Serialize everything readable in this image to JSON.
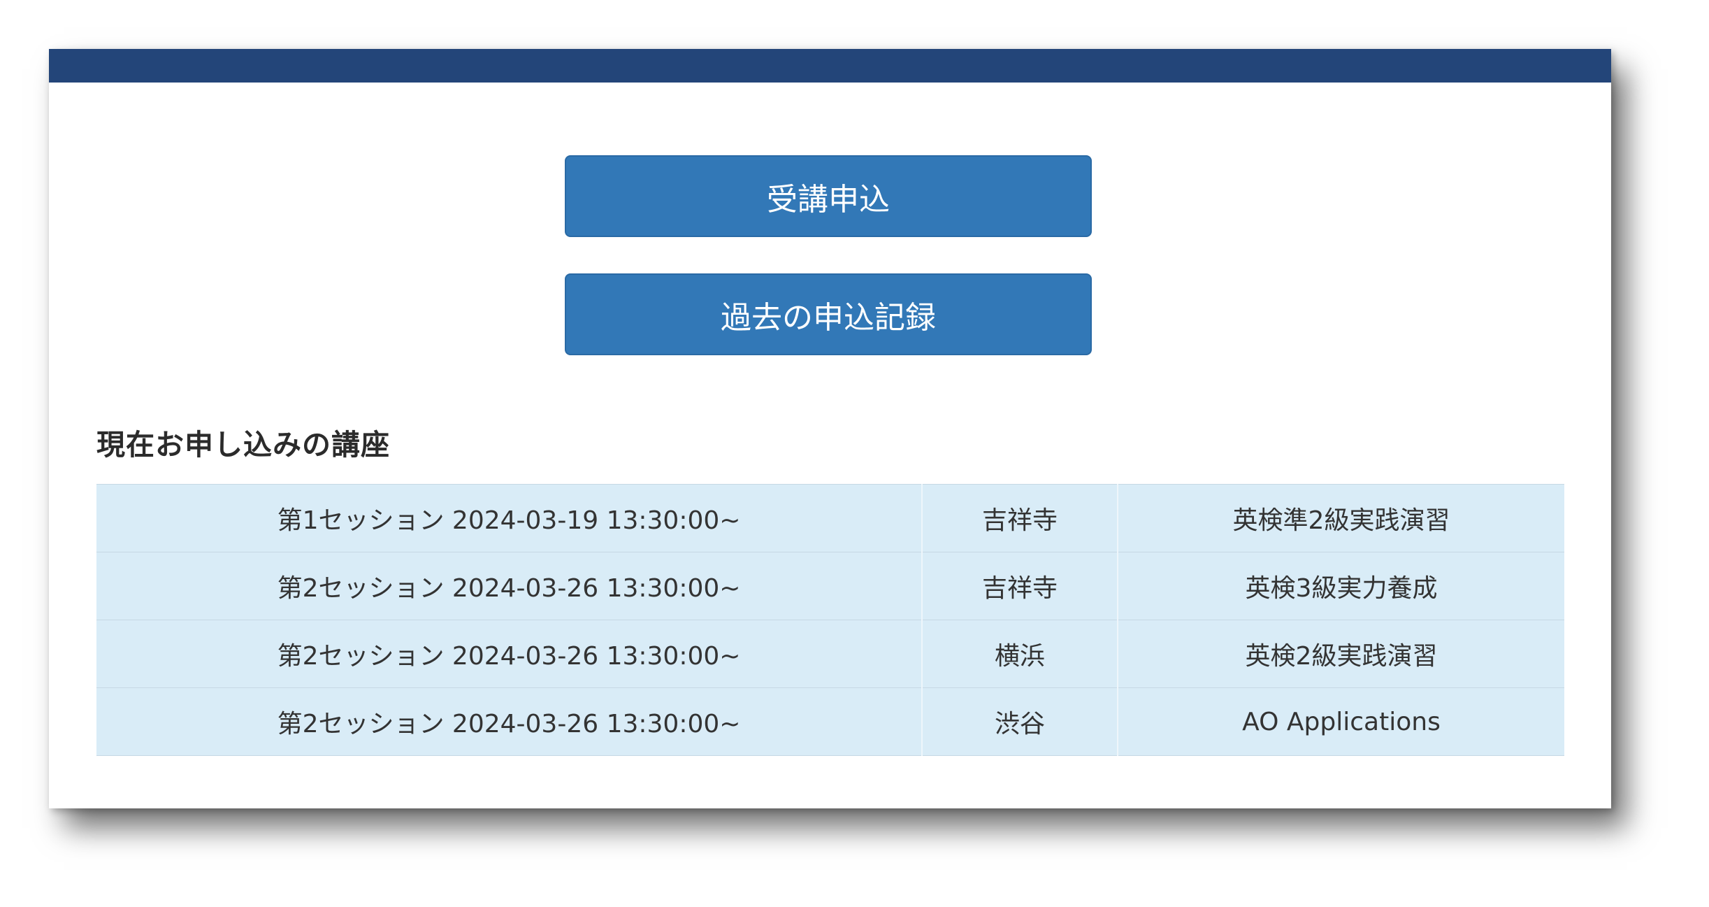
{
  "buttons": {
    "apply_label": "受講申込",
    "history_label": "過去の申込記録"
  },
  "section": {
    "title": "現在お申し込みの講座"
  },
  "enrollments": [
    {
      "session": "第1セッション 2024-03-19 13:30:00~",
      "place": "吉祥寺",
      "course": "英検準2級実践演習"
    },
    {
      "session": "第2セッション 2024-03-26 13:30:00~",
      "place": "吉祥寺",
      "course": "英検3級実力養成"
    },
    {
      "session": "第2セッション 2024-03-26 13:30:00~",
      "place": "横浜",
      "course": "英検2級実践演習"
    },
    {
      "session": "第2セッション 2024-03-26 13:30:00~",
      "place": "渋谷",
      "course": "AO Applications"
    }
  ],
  "colors": {
    "topbar": "#234579",
    "button": "#3278b7",
    "row_background": "#d9ecf7"
  }
}
